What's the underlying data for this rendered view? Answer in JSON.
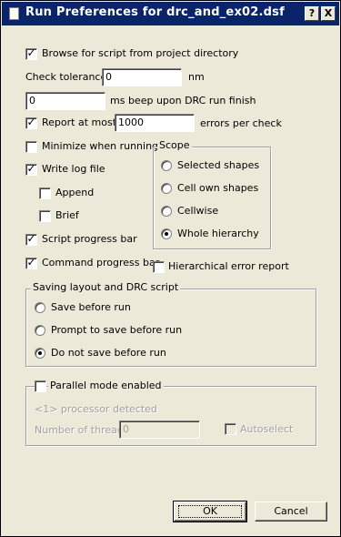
{
  "window": {
    "title": "Run Preferences for drc_and_ex02.dsf",
    "help_button": "?",
    "close_button": "X"
  },
  "options": {
    "browse_script": {
      "label": "Browse for script from project directory",
      "checked": true
    },
    "check_tolerance": {
      "label": "Check tolerance",
      "value": "0",
      "unit": "nm"
    },
    "beep": {
      "value": "0",
      "label": "ms beep upon DRC run finish"
    },
    "report_at_most": {
      "label": "Report at most",
      "checked": true,
      "value": "1000",
      "unit": "errors per check"
    },
    "minimize": {
      "label": "Minimize when running",
      "checked": false
    },
    "write_log": {
      "label": "Write log file",
      "checked": true
    },
    "append": {
      "label": "Append",
      "checked": false
    },
    "brief": {
      "label": "Brief",
      "checked": false
    },
    "script_progress": {
      "label": "Script progress bar",
      "checked": true
    },
    "command_progress": {
      "label": "Command  progress bar",
      "checked": true
    },
    "hierarchical_report": {
      "label": "Hierarchical error report",
      "checked": false
    }
  },
  "scope": {
    "title": "Scope",
    "options": [
      {
        "label": "Selected shapes",
        "selected": false
      },
      {
        "label": "Cell own shapes",
        "selected": false
      },
      {
        "label": "Cellwise",
        "selected": false
      },
      {
        "label": "Whole hierarchy",
        "selected": true
      }
    ]
  },
  "saving": {
    "title": "Saving layout and DRC script",
    "options": [
      {
        "label": "Save before run",
        "selected": false
      },
      {
        "label": "Prompt to save before run",
        "selected": false
      },
      {
        "label": "Do not save before run",
        "selected": true
      }
    ]
  },
  "parallel": {
    "label": "Parallel mode enabled",
    "checked": false,
    "processor_text": "<1> processor detected",
    "threads_label": "Number of threads",
    "threads_value": "0",
    "autoselect_label": "Autoselect",
    "autoselect_checked": false
  },
  "buttons": {
    "ok": "OK",
    "cancel": "Cancel"
  }
}
